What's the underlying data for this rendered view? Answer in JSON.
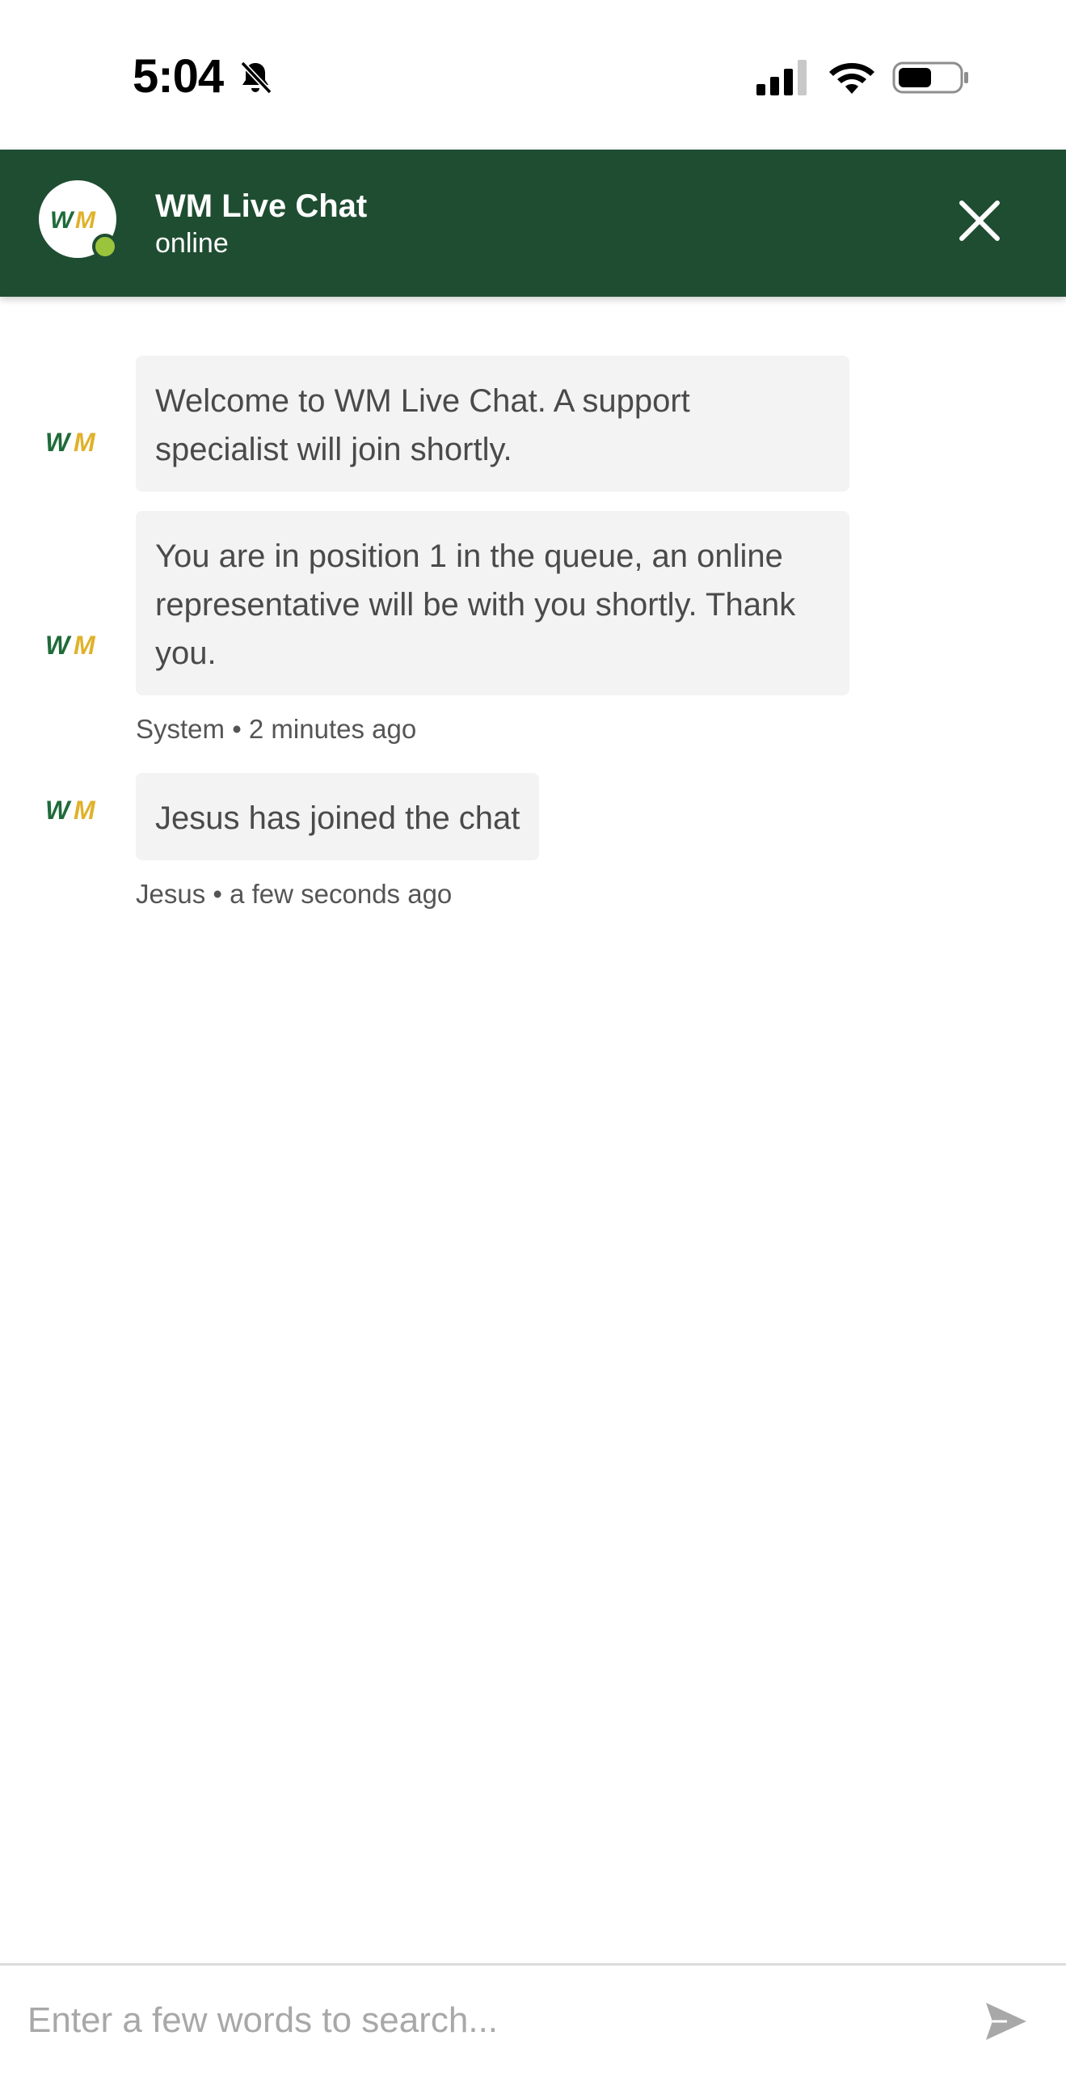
{
  "status_bar": {
    "time": "5:04"
  },
  "header": {
    "title": "WM Live Chat",
    "status": "online"
  },
  "messages": [
    {
      "text": "Welcome to WM Live Chat. A support specialist will join shortly."
    },
    {
      "text": "You are in position 1 in the queue, an online representative will be with you shortly. Thank you.",
      "meta": "System • 2 minutes ago"
    },
    {
      "text": "Jesus has joined the chat",
      "meta": "Jesus • a few seconds ago"
    }
  ],
  "input": {
    "placeholder": "Enter a few words to search..."
  },
  "colors": {
    "header_bg": "#1f4d32",
    "online_dot": "#9bc43d",
    "logo_green": "#1f6b3a",
    "logo_gold": "#e0b12a",
    "bubble_bg": "#f3f3f3"
  }
}
